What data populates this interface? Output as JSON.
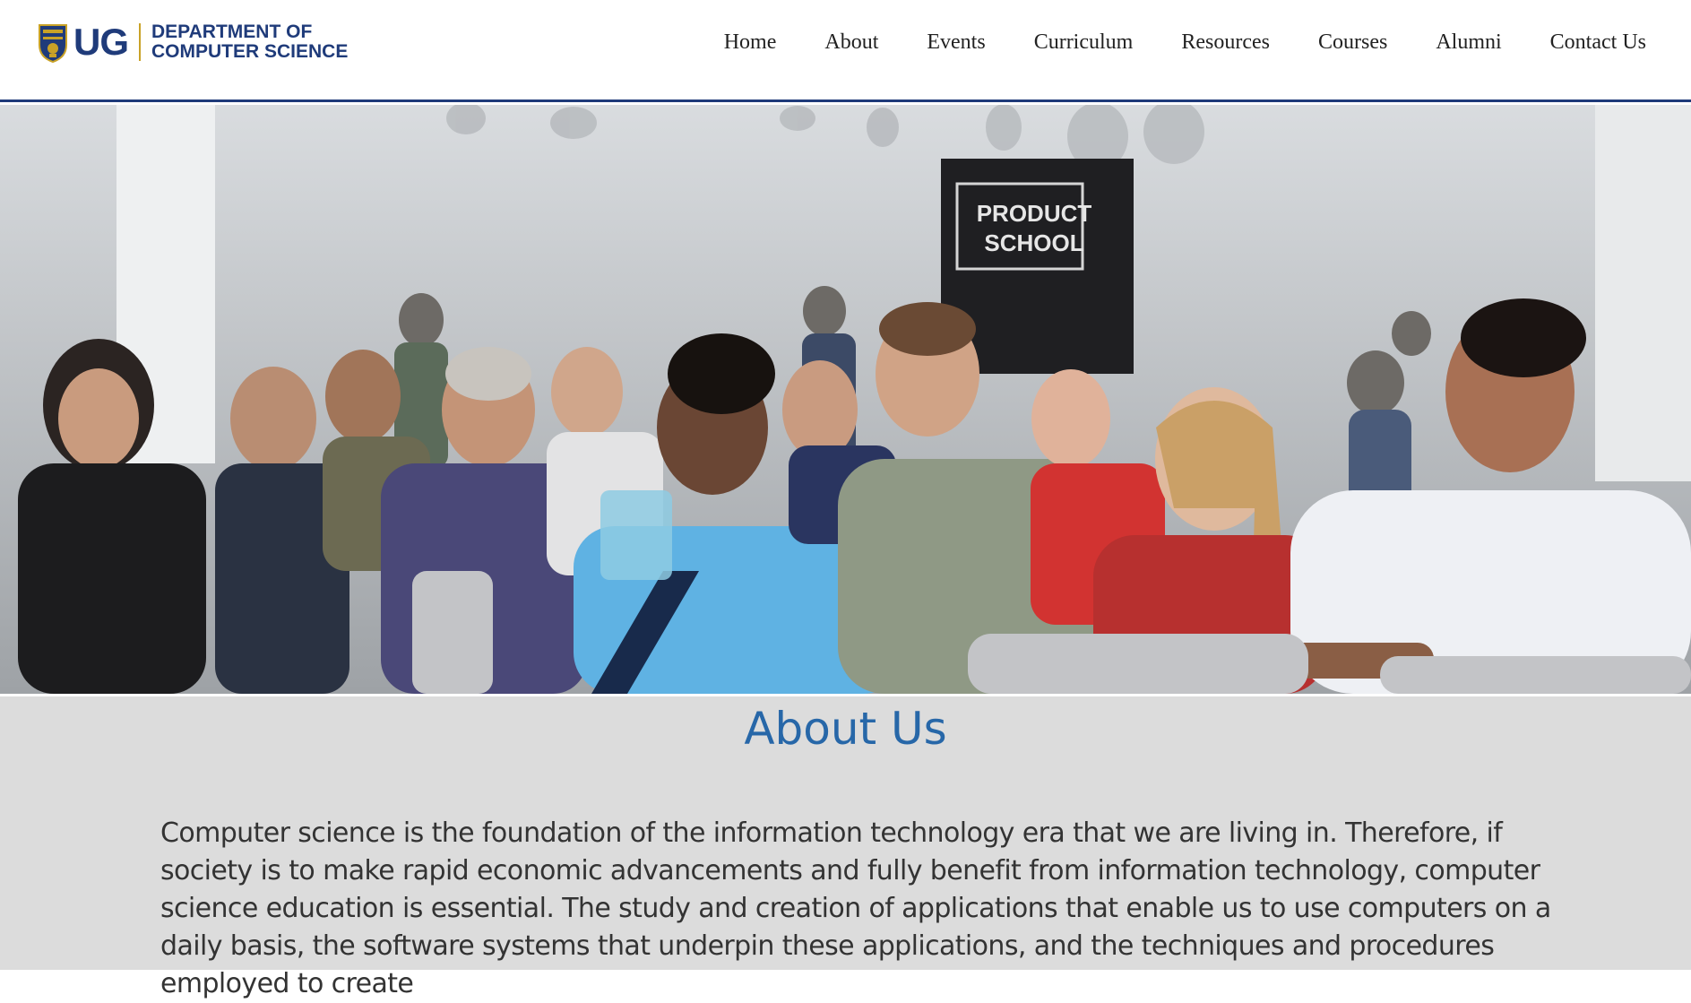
{
  "logo": {
    "mark": "UG",
    "line1": "DEPARTMENT OF",
    "line2": "COMPUTER SCIENCE",
    "crest_icon": "university-crest-icon"
  },
  "nav": {
    "items": [
      "Home",
      "About",
      "Events",
      "Curriculum",
      "Resources",
      "Courses",
      "Alumni",
      "Contact Us"
    ]
  },
  "hero": {
    "banner_text_1": "PRODUCT",
    "banner_text_2": "SCHOOL"
  },
  "about": {
    "title": "About Us",
    "body": "Computer science is the foundation of the information technology era that we are living in. Therefore, if society is to make rapid economic advancements and fully benefit from information technology, computer science education is essential. The study and creation of applications that enable us to use computers on a daily basis, the software systems that underpin these applications, and the techniques and procedures employed to create"
  },
  "colors": {
    "brand_blue": "#1f3b7a",
    "title_blue": "#2767a8",
    "about_bg": "#dcdcdc"
  }
}
